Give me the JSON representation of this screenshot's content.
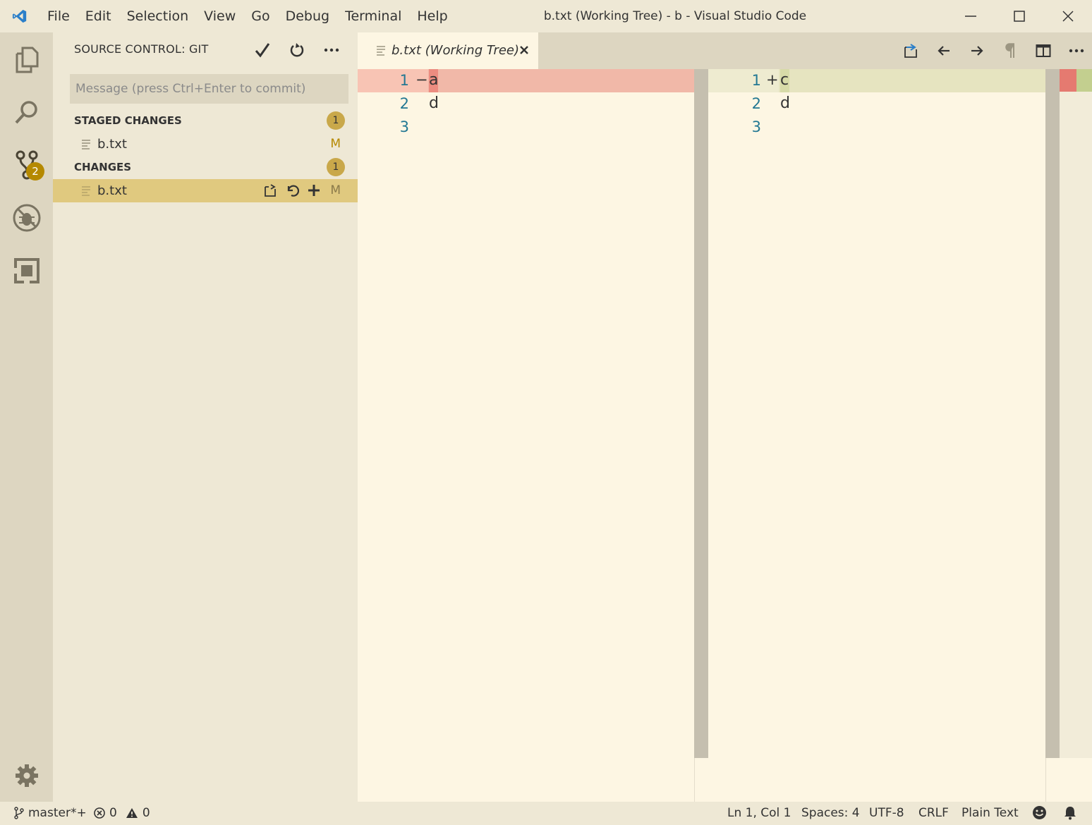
{
  "titlebar": {
    "menu": [
      "File",
      "Edit",
      "Selection",
      "View",
      "Go",
      "Debug",
      "Terminal",
      "Help"
    ],
    "window_title": "b.txt (Working Tree) - b - Visual Studio Code"
  },
  "activitybar": {
    "scm_badge": "2"
  },
  "sidebar": {
    "title": "SOURCE CONTROL: GIT",
    "commit_placeholder": "Message (press Ctrl+Enter to commit)",
    "staged": {
      "label": "STAGED CHANGES",
      "count": "1",
      "files": [
        {
          "name": "b.txt",
          "status": "M"
        }
      ]
    },
    "changes": {
      "label": "CHANGES",
      "count": "1",
      "files": [
        {
          "name": "b.txt",
          "status": "M"
        }
      ]
    }
  },
  "editor": {
    "tab_label": "b.txt (Working Tree)",
    "left": {
      "lines": [
        {
          "num": "1",
          "sign": "−",
          "text": "a"
        },
        {
          "num": "2",
          "sign": "",
          "text": "d"
        },
        {
          "num": "3",
          "sign": "",
          "text": ""
        }
      ]
    },
    "right": {
      "lines": [
        {
          "num": "1",
          "sign": "+",
          "text": "c"
        },
        {
          "num": "2",
          "sign": "",
          "text": "d"
        },
        {
          "num": "3",
          "sign": "",
          "text": ""
        }
      ]
    }
  },
  "statusbar": {
    "branch": "master*+",
    "errors": "0",
    "warnings": "0",
    "position": "Ln 1, Col 1",
    "spaces": "Spaces: 4",
    "encoding": "UTF-8",
    "eol": "CRLF",
    "language": "Plain Text"
  },
  "colors": {
    "accent": "#b58900",
    "removed_line": "#f1b8a8",
    "added_line": "#e6e4c0",
    "line_number": "#237893"
  }
}
